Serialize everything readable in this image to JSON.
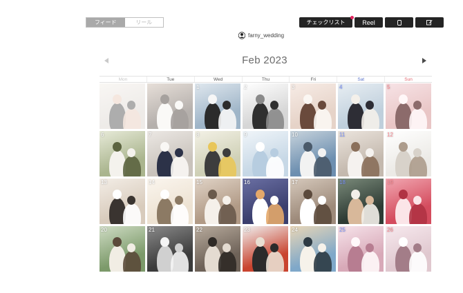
{
  "toggle": {
    "feed_label": "フィード",
    "reel_label": "リール"
  },
  "toolbar": {
    "checklist_label": "チェックリスト",
    "reel_label": "Reel",
    "accent": "#e2245f"
  },
  "account": {
    "username": "farny_wedding",
    "icon": "account-icon"
  },
  "calendar": {
    "month": "Feb 2023",
    "weekdays": [
      "Mon",
      "Tue",
      "Wed",
      "Thu",
      "Fri",
      "Sat",
      "Sun"
    ],
    "colors": {
      "sat": "#5a72c9",
      "sun": "#e2676f"
    },
    "cells": [
      {
        "day": "",
        "faded": true
      },
      {
        "day": "",
        "faded": true
      },
      {
        "day": "1",
        "faded": false
      },
      {
        "day": "2",
        "faded": false
      },
      {
        "day": "3",
        "faded": false
      },
      {
        "day": "4",
        "faded": false
      },
      {
        "day": "5",
        "faded": false
      },
      {
        "day": "6",
        "faded": false
      },
      {
        "day": "7",
        "faded": false
      },
      {
        "day": "8",
        "faded": false
      },
      {
        "day": "9",
        "faded": false
      },
      {
        "day": "10",
        "faded": false
      },
      {
        "day": "11",
        "faded": false
      },
      {
        "day": "12",
        "faded": false
      },
      {
        "day": "13",
        "faded": false
      },
      {
        "day": "14",
        "faded": false
      },
      {
        "day": "15",
        "faded": false
      },
      {
        "day": "16",
        "faded": false
      },
      {
        "day": "17",
        "faded": false
      },
      {
        "day": "18",
        "faded": false
      },
      {
        "day": "19",
        "faded": false
      },
      {
        "day": "20",
        "faded": false
      },
      {
        "day": "21",
        "faded": false
      },
      {
        "day": "22",
        "faded": false
      },
      {
        "day": "23",
        "faded": false
      },
      {
        "day": "24",
        "faded": false
      },
      {
        "day": "25",
        "faded": false
      },
      {
        "day": "26",
        "faded": false
      }
    ]
  }
}
